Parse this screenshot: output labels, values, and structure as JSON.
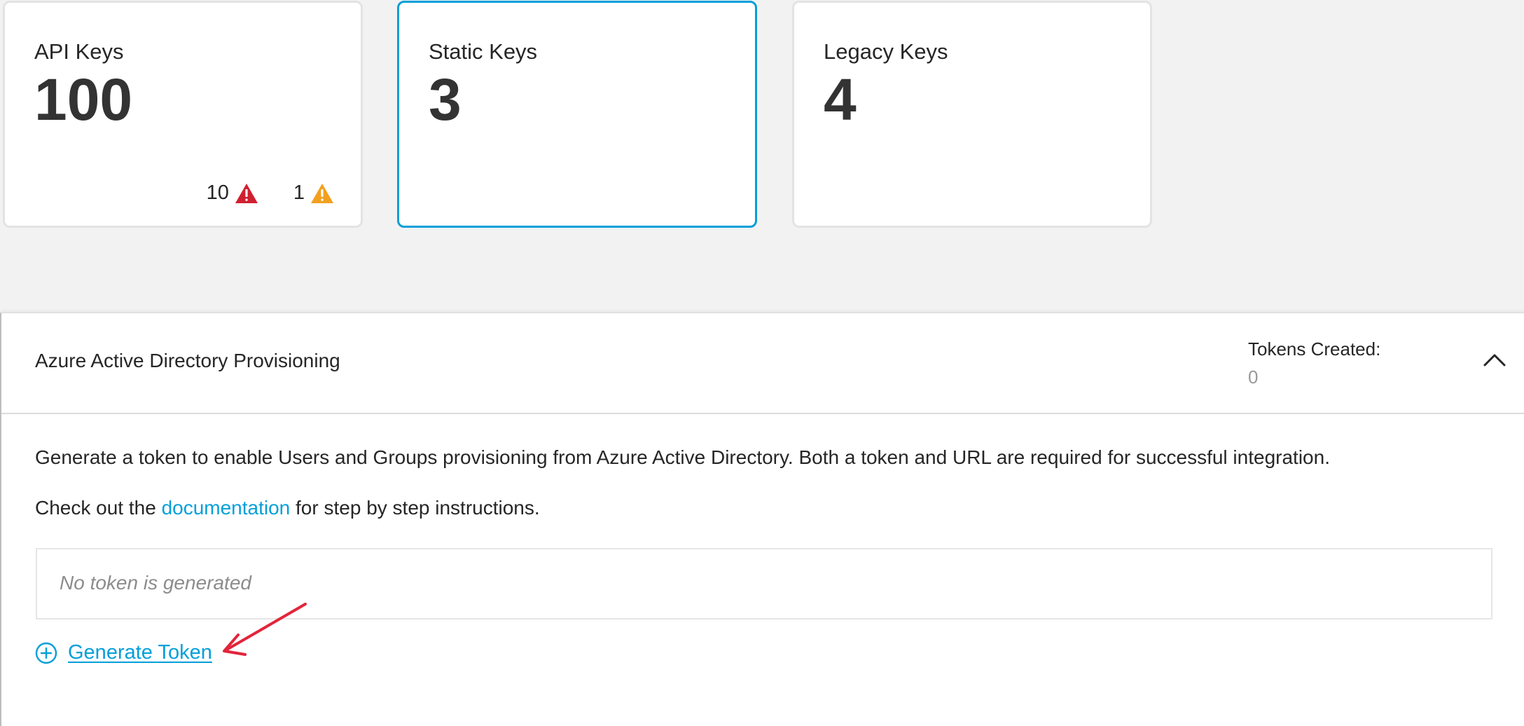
{
  "cards": [
    {
      "title": "API Keys",
      "count": "100",
      "error_count": "10",
      "warning_count": "1"
    },
    {
      "title": "Static Keys",
      "count": "3"
    },
    {
      "title": "Legacy Keys",
      "count": "4"
    }
  ],
  "panel": {
    "title": "Azure Active Directory Provisioning",
    "tokens_label": "Tokens Created:",
    "tokens_value": "0",
    "description": "Generate a token to enable Users and Groups provisioning from Azure Active Directory. Both a token and URL are required for successful integration.",
    "doc_prefix": "Check out the ",
    "doc_link": "documentation",
    "doc_suffix": " for step by step instructions.",
    "empty_token_text": "No token is generated",
    "generate_label": "Generate Token"
  },
  "colors": {
    "accent": "#049fd9",
    "error": "#cf2030",
    "warning": "#f2a01f",
    "annotation_arrow": "#e3243b"
  },
  "icons": {
    "error": "error-triangle-icon",
    "warning": "warning-triangle-icon",
    "collapse": "chevron-up-icon",
    "add": "plus-circle-icon"
  }
}
